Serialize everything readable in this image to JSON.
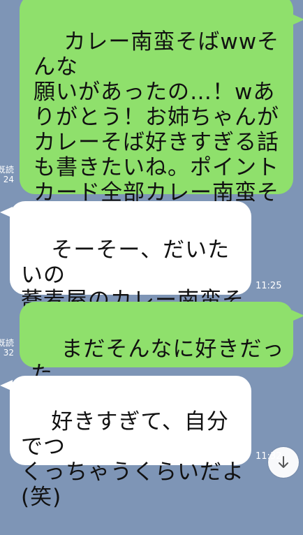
{
  "messages": [
    {
      "side": "sent",
      "text": "カレー南蛮そばwwそんな\n願いがあったの…！wあ\nりがとう！お姉ちゃんが\nカレーそば好きすぎる話\nも書きたいね。ポイント\nカード全部カレー南蛮そ\nばでためたんだっけ",
      "read_label": "既読",
      "time": "24"
    },
    {
      "side": "recv",
      "text": "そーそー、だいたいの\n蕎麦屋のカレー南蛮そ\nばを制覇したい！",
      "time": "11:25"
    },
    {
      "side": "sent",
      "text": "まだそんなに好きだった\nんだね（笑）",
      "read_label": "既読",
      "time": "32"
    },
    {
      "side": "recv",
      "text": "好きすぎて、自分でつ\nくっちゃうくらいだよ\n(笑)",
      "time": "11:32"
    }
  ],
  "scroll_down": {
    "icon": "arrow-down-icon"
  },
  "colors": {
    "background": "#7e95b6",
    "sent_bubble": "#8fe06c",
    "received_bubble": "#ffffff"
  }
}
